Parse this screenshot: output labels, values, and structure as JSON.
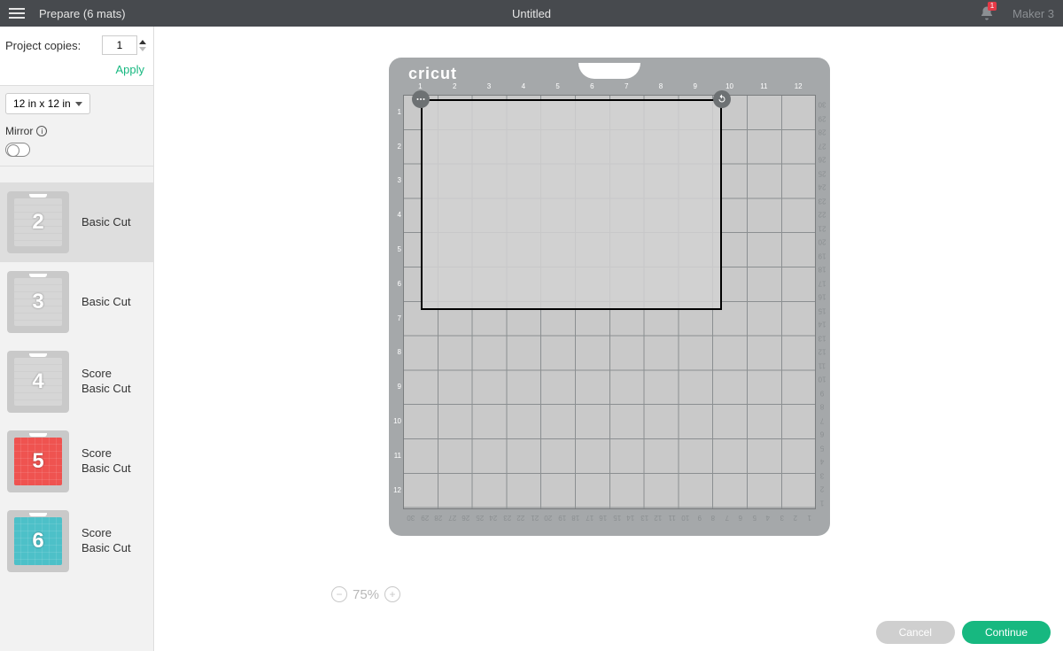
{
  "header": {
    "title_left": "Prepare (6 mats)",
    "title_center": "Untitled",
    "device": "Maker 3",
    "notifications": "1"
  },
  "sidebar": {
    "project_copies_label": "Project copies:",
    "project_copies_value": "1",
    "apply_label": "Apply",
    "mat_size": "12 in x 12 in",
    "mirror_label": "Mirror",
    "mats": [
      {
        "num": "2",
        "label": "Basic Cut",
        "color": "gray",
        "active": true
      },
      {
        "num": "3",
        "label": "Basic Cut",
        "color": "gray",
        "active": false
      },
      {
        "num": "4",
        "label": "Score\nBasic Cut",
        "color": "gray",
        "active": false
      },
      {
        "num": "5",
        "label": "Score\nBasic Cut",
        "color": "red",
        "active": false
      },
      {
        "num": "6",
        "label": "Score\nBasic Cut",
        "color": "teal",
        "active": false
      }
    ]
  },
  "canvas": {
    "brand": "cricut",
    "ruler_top": [
      "1",
      "2",
      "3",
      "4",
      "5",
      "6",
      "7",
      "8",
      "9",
      "10",
      "11",
      "12"
    ],
    "ruler_left": [
      "1",
      "2",
      "3",
      "4",
      "5",
      "6",
      "7",
      "8",
      "9",
      "10",
      "11",
      "12"
    ],
    "ruler_cm": [
      "1",
      "2",
      "3",
      "4",
      "5",
      "6",
      "7",
      "8",
      "9",
      "10",
      "11",
      "12",
      "13",
      "14",
      "15",
      "16",
      "17",
      "18",
      "19",
      "20",
      "21",
      "22",
      "23",
      "24",
      "25",
      "26",
      "27",
      "28",
      "29",
      "30"
    ]
  },
  "zoom": {
    "level": "75%"
  },
  "footer": {
    "cancel": "Cancel",
    "continue": "Continue"
  }
}
